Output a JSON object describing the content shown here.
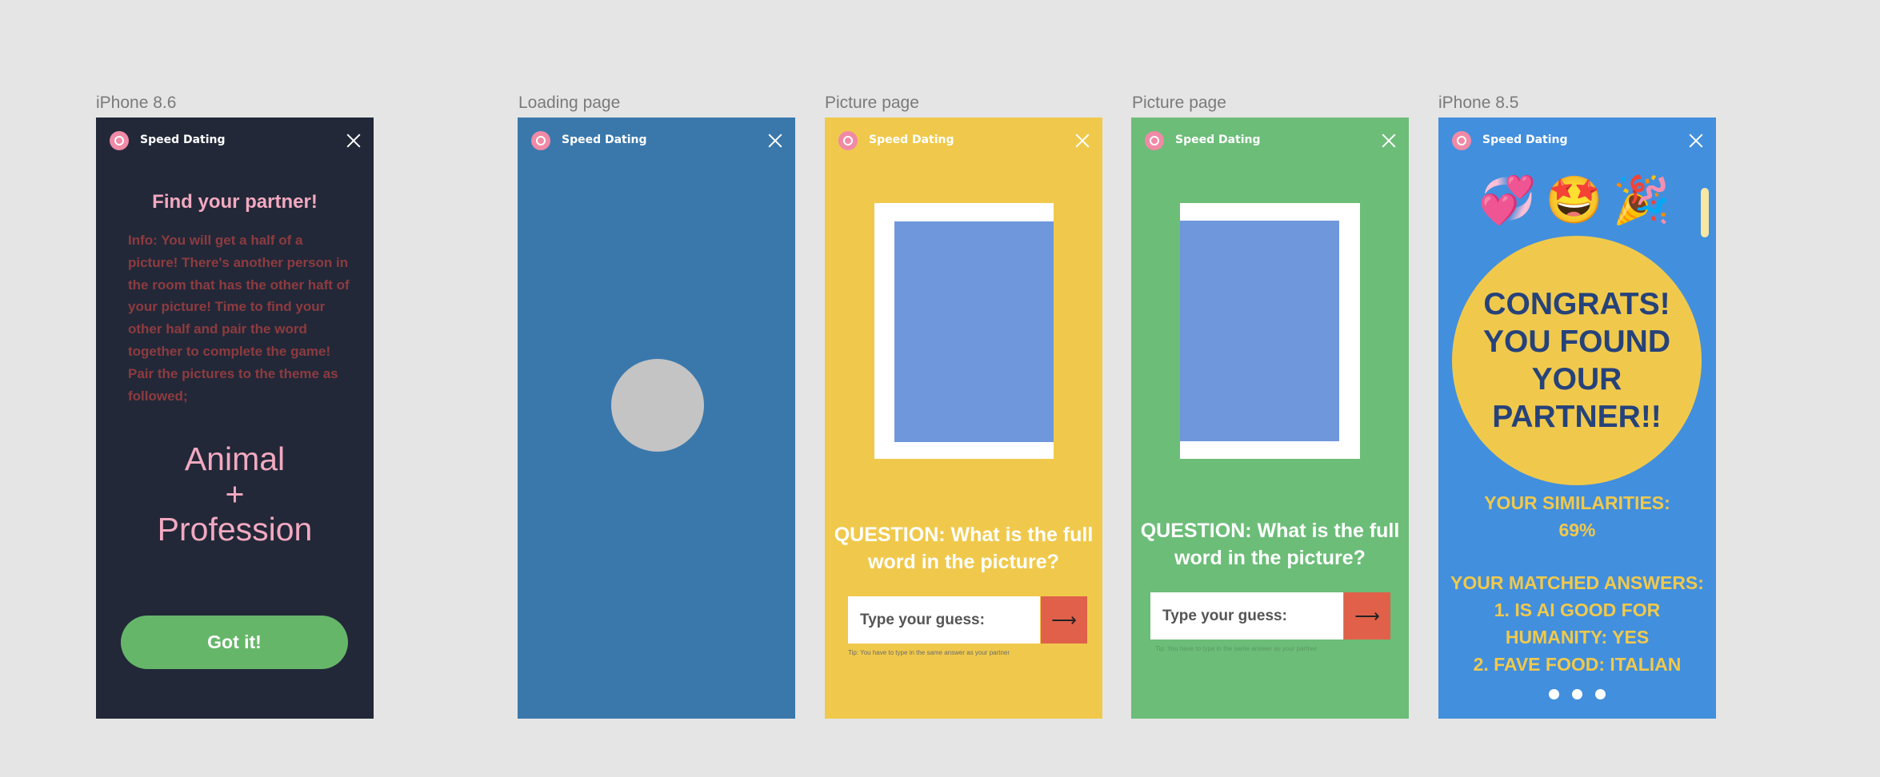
{
  "app_name": "Speed Dating",
  "frames": {
    "f1": {
      "label": "iPhone 8.6",
      "title": "Find your partner!",
      "info": "Info: You will get a half of a picture! There's another person in the room that has the other haft of your picture! Time to find your other half and pair the word together to complete the game! Pair the pictures to the theme as followed;",
      "theme_line1": "Animal",
      "theme_line2": "+",
      "theme_line3": "Profession",
      "button": "Got it!"
    },
    "f2": {
      "label": "Loading page"
    },
    "f3": {
      "label": "Picture page",
      "question": "QUESTION: What is the full word in the picture?",
      "input_placeholder": "Type your guess:",
      "submit_icon": "⟶",
      "tip": "Tip: You have to type in the same answer as your partner"
    },
    "f4": {
      "label": "Picture page",
      "question": "QUESTION: What is the full word in the picture?",
      "input_placeholder": "Type your guess:",
      "submit_icon": "⟶",
      "tip": "Tip: You have to type in the same answer as your partner"
    },
    "f5": {
      "label": "iPhone 8.5",
      "emojis": [
        "💞",
        "🤩",
        "🎉"
      ],
      "congrats": "CONGRATS! YOU FOUND YOUR PARTNER!!",
      "similarities_label": "YOUR SIMILARITIES:",
      "similarities_value": "69%",
      "matched_label": "YOUR MATCHED ANSWERS:",
      "answer1": "1. IS AI GOOD FOR HUMANITY: YES",
      "answer2": "2. FAVE FOOD: ITALIAN"
    }
  },
  "colors": {
    "frame1_bg": "#222838",
    "frame2_bg": "#3a78ac",
    "frame3_bg": "#f0c94c",
    "frame4_bg": "#6cbd78",
    "frame5_bg": "#428fde",
    "accent_pink": "#f2a9c0",
    "button_green": "#66b66a",
    "submit_red": "#e0604a",
    "picture_blue": "#6f97db"
  },
  "icons": [
    "app-logo-icon",
    "close-icon",
    "arrow-right-icon"
  ]
}
